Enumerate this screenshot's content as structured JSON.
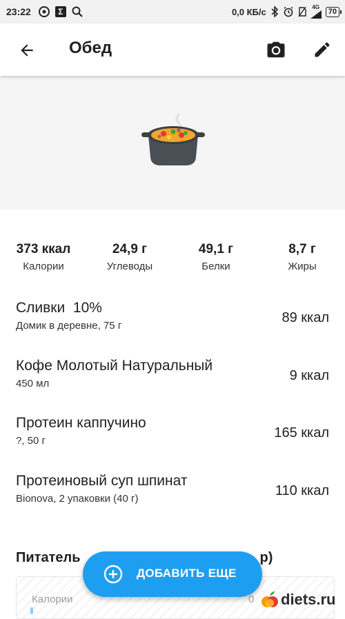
{
  "status_bar": {
    "time": "23:22",
    "network_speed": "0,0 КБ/с",
    "network_type": "4G",
    "battery": "70",
    "icons": [
      "target-icon",
      "sigma-icon",
      "search-icon",
      "bluetooth-icon",
      "alarm-icon",
      "sim-off-icon",
      "signal-icon",
      "battery-icon"
    ]
  },
  "app_bar": {
    "title": "Обед",
    "back_icon": "arrow-back-icon",
    "camera_icon": "camera-icon",
    "edit_icon": "pencil-icon"
  },
  "hero": {
    "image": "pot-of-food-emoji"
  },
  "macros": [
    {
      "value": "373 ккал",
      "label": "Калории"
    },
    {
      "value": "24,9 г",
      "label": "Углеводы"
    },
    {
      "value": "49,1 г",
      "label": "Белки"
    },
    {
      "value": "8,7 г",
      "label": "Жиры"
    }
  ],
  "foods": [
    {
      "name": "Сливки  10%",
      "detail": "Домик в деревне, 75 г",
      "kcal": "89 ккал"
    },
    {
      "name": "Кофе Молотый Натуральный",
      "detail": "450 мл",
      "kcal": "9 ккал"
    },
    {
      "name": "Протеин каппучино",
      "detail": "?, 50 г",
      "kcal": "165 ккал"
    },
    {
      "name": "Протеиновый суп шпинат",
      "detail": "Bionova, 2 упаковки (40 г)",
      "kcal": "110 ккал"
    }
  ],
  "nutrients": {
    "title": "Питатель",
    "title_tail": "р)",
    "first_row_label": "Калории",
    "first_row_value": "0"
  },
  "fab": {
    "label": "ДОБАВИТЬ ЕЩЕ",
    "icon": "add-circle-icon",
    "color": "#1e9ef0"
  },
  "watermark": {
    "text": "diets.ru",
    "icon": "apple-logo-icon"
  }
}
